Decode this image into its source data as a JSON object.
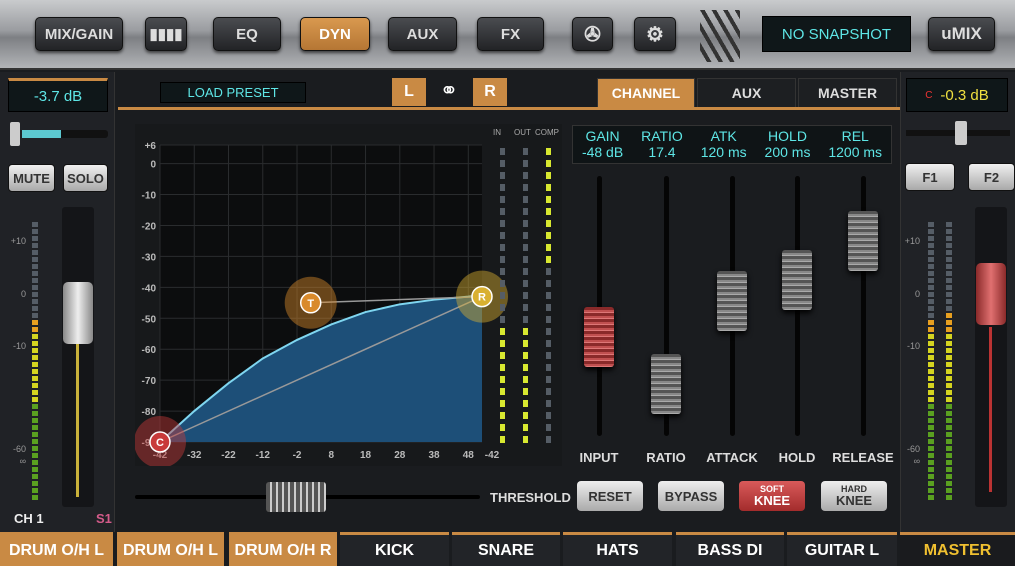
{
  "topbar": {
    "mix_gain": "MIX/GAIN",
    "eq": "EQ",
    "dyn": "DYN",
    "aux": "AUX",
    "fx": "FX",
    "snapshot": "NO SNAPSHOT",
    "logo": "uMIX",
    "icons": [
      "meter-bars-icon",
      "film-reel-icon",
      "gear-icon"
    ]
  },
  "left_strip": {
    "gain": "-3.7 dB",
    "mute": "MUTE",
    "solo": "SOLO",
    "channel": "CH 1",
    "slot": "S1",
    "pan_fraction": 0.45,
    "scale": [
      "+10",
      "0",
      "-10",
      "-60",
      "∞"
    ]
  },
  "right_strip": {
    "prefix": "C",
    "gain": "-0.3 dB",
    "f1": "F1",
    "f2": "F2",
    "scale": [
      "+10",
      "0",
      "-10",
      "-60",
      "∞"
    ]
  },
  "header": {
    "load_preset": "LOAD PRESET",
    "left": "L",
    "right": "R",
    "tabs": [
      "CHANNEL",
      "AUX",
      "MASTER"
    ],
    "active_tab": "CHANNEL"
  },
  "meters": {
    "in": "IN",
    "out": "OUT",
    "comp": "COMP"
  },
  "threshold_label": "THRESHOLD",
  "params": {
    "headers": [
      "GAIN",
      "RATIO",
      "ATK",
      "HOLD",
      "REL"
    ],
    "values": [
      "-48 dB",
      "17.4",
      "120 ms",
      "200 ms",
      "1200 ms"
    ]
  },
  "faders": [
    {
      "label": "INPUT",
      "level": 0.38
    },
    {
      "label": "RATIO",
      "level": 0.2
    },
    {
      "label": "ATTACK",
      "level": 0.52
    },
    {
      "label": "HOLD",
      "level": 0.6
    },
    {
      "label": "RELEASE",
      "level": 0.75
    }
  ],
  "buttons": {
    "reset": "RESET",
    "bypass": "BYPASS",
    "soft_top": "SOFT",
    "soft_bottom": "KNEE",
    "hard_top": "HARD",
    "hard_bottom": "KNEE"
  },
  "channels": [
    "DRUM O/H L",
    "DRUM O/H L",
    "DRUM O/H R",
    "KICK",
    "SNARE",
    "HATS",
    "BASS DI",
    "GUITAR L",
    "MASTER"
  ],
  "chart_data": {
    "type": "line",
    "x_ticks": [
      "-42",
      "-32",
      "-22",
      "-12",
      "-2",
      "8",
      "18",
      "28",
      "38",
      "48",
      "-42"
    ],
    "y_ticks": [
      "+6",
      "0",
      "-10",
      "-20",
      "-30",
      "-40",
      "-50",
      "-60",
      "-70",
      "-80",
      "-90"
    ],
    "xlim": [
      -42,
      52
    ],
    "ylim": [
      -90,
      6
    ],
    "curve": [
      [
        -42,
        -90
      ],
      [
        -32,
        -80
      ],
      [
        -22,
        -71
      ],
      [
        -12,
        -63
      ],
      [
        -2,
        -57
      ],
      [
        8,
        -52
      ],
      [
        18,
        -48
      ],
      [
        28,
        -45.5
      ],
      [
        38,
        -44
      ],
      [
        48,
        -43
      ],
      [
        52,
        -42.5
      ]
    ],
    "points": [
      {
        "label": "T",
        "x": 2,
        "y": -45
      },
      {
        "label": "R",
        "x": 52,
        "y": -43
      },
      {
        "label": "C",
        "x": -42,
        "y": -90
      }
    ],
    "colors": {
      "fill": "#1d4f78",
      "line": "#7fd6f0",
      "T": "#d98a2b",
      "R": "#d9b030",
      "C": "#c83a3a"
    }
  }
}
